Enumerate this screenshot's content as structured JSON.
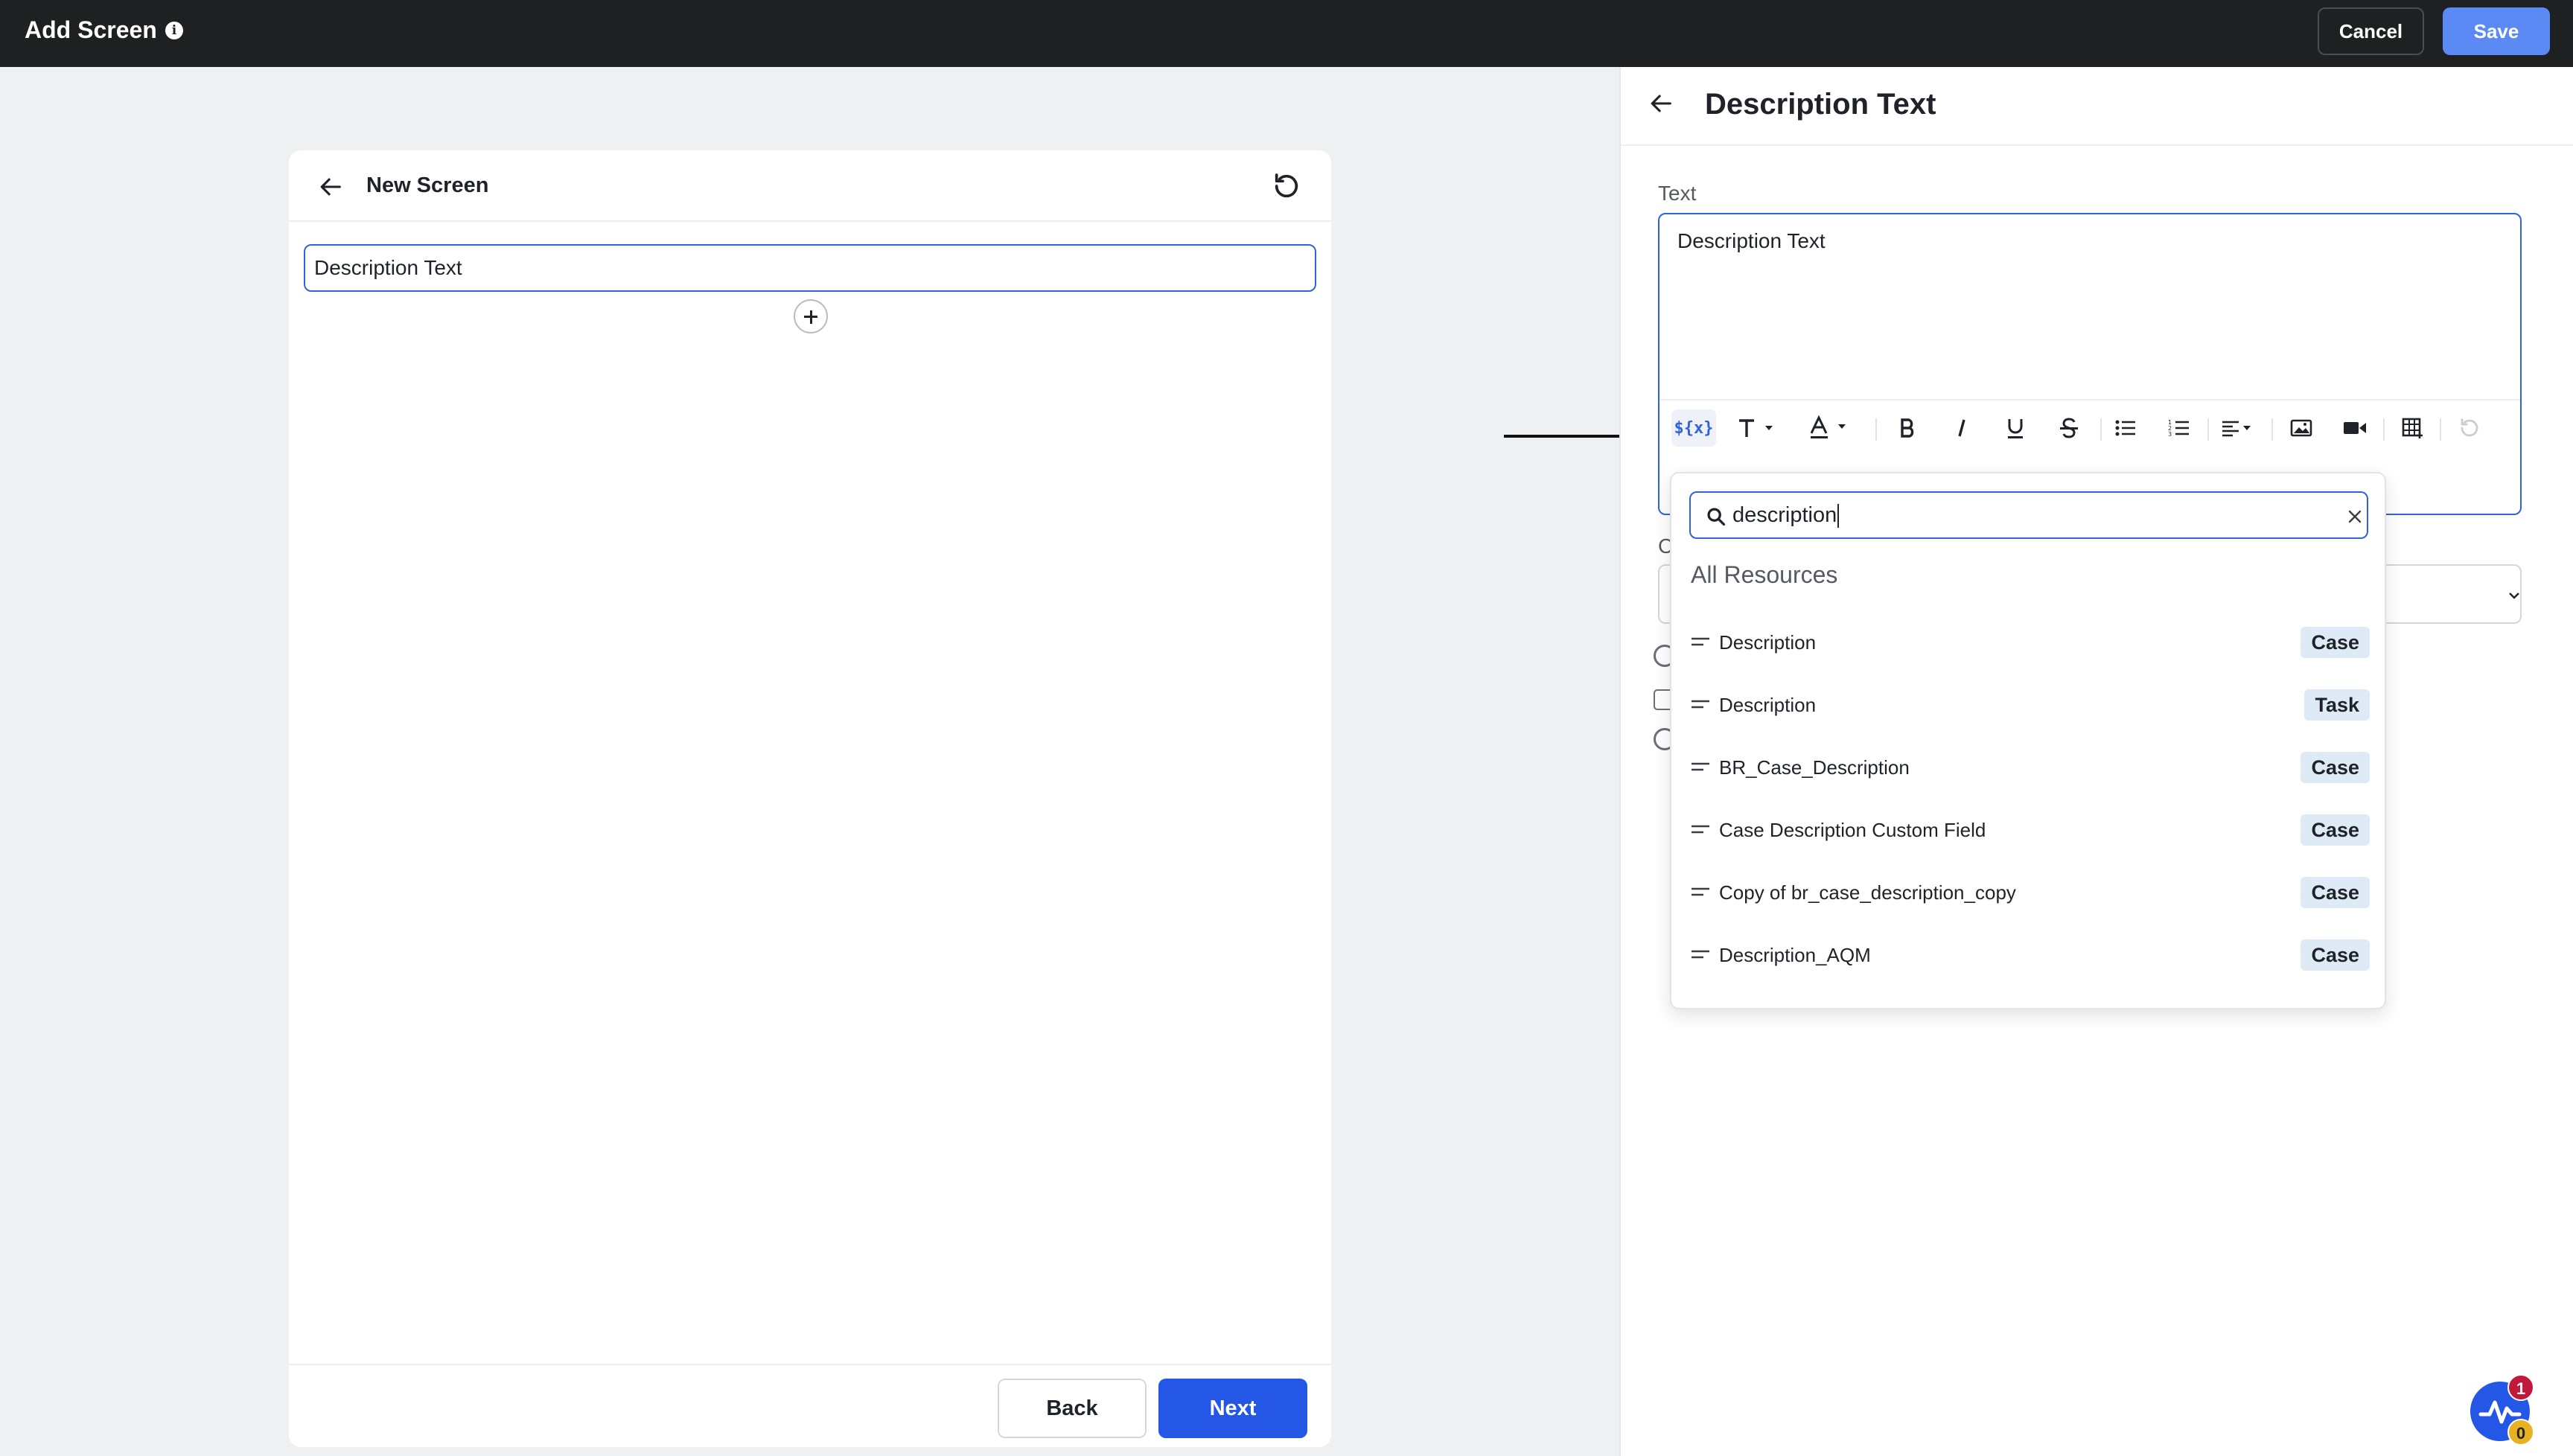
{
  "topbar": {
    "title": "Add Screen",
    "info_icon": "info-icon",
    "cancel_label": "Cancel",
    "save_label": "Save",
    "save_color": "#5b8af5"
  },
  "canvas": {
    "title": "New Screen",
    "field_value": "Description Text",
    "back_label": "Back",
    "next_label": "Next",
    "accent": "#2457e6"
  },
  "panel": {
    "title": "Description Text",
    "text_label": "Text",
    "editor_value": "Description Text",
    "ghost_label": "C",
    "toolbar": {
      "variable_label": "${x}",
      "icons": [
        "variable-icon",
        "text-size-icon",
        "font-color-icon",
        "bold-icon",
        "italic-icon",
        "underline-icon",
        "strikethrough-icon",
        "bullet-list-icon",
        "numbered-list-icon",
        "align-icon",
        "image-icon",
        "video-icon",
        "table-icon",
        "undo-icon"
      ]
    }
  },
  "dropdown": {
    "search_value": "description",
    "group_title": "All Resources",
    "items": [
      {
        "name": "Description",
        "tag": "Case"
      },
      {
        "name": "Description",
        "tag": "Task"
      },
      {
        "name": "BR_Case_Description",
        "tag": "Case"
      },
      {
        "name": "Case Description Custom Field",
        "tag": "Case"
      },
      {
        "name": "Copy of br_case_description_copy",
        "tag": "Case"
      },
      {
        "name": "Description_AQM",
        "tag": "Case"
      }
    ]
  },
  "widget": {
    "badge_top": "1",
    "badge_bottom": "0"
  }
}
